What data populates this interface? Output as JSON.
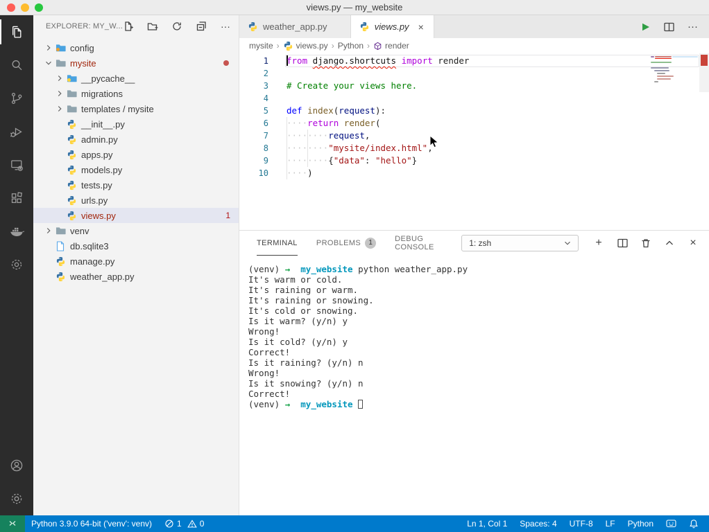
{
  "window": {
    "title": "views.py — my_website"
  },
  "activity_bar": {
    "items_top": [
      "explorer-icon",
      "search-icon",
      "source-control-icon",
      "run-debug-icon",
      "remote-explorer-icon",
      "extensions-icon",
      "docker-icon",
      "gear-badge-icon"
    ],
    "items_bottom": [
      "account-icon",
      "settings-gear-icon"
    ],
    "active": "explorer-icon"
  },
  "sidebar": {
    "title": "EXPLORER: MY_W...",
    "actions": [
      {
        "name": "new-file",
        "glyph": ""
      },
      {
        "name": "new-folder",
        "glyph": ""
      },
      {
        "name": "refresh",
        "glyph": ""
      },
      {
        "name": "collapse-all",
        "glyph": ""
      },
      {
        "name": "more",
        "glyph": "···"
      }
    ],
    "tree": [
      {
        "label": "config",
        "depth": 0,
        "chevron": "right",
        "icon": "folder-config"
      },
      {
        "label": "mysite",
        "depth": 0,
        "chevron": "down",
        "icon": "folder-gray",
        "error": true,
        "dot": true
      },
      {
        "label": "__pycache__",
        "depth": 1,
        "chevron": "right",
        "icon": "folder-python"
      },
      {
        "label": "migrations",
        "depth": 1,
        "chevron": "right",
        "icon": "folder-gray"
      },
      {
        "label": "templates / mysite",
        "depth": 1,
        "chevron": "right",
        "icon": "folder-gray"
      },
      {
        "label": "__init__.py",
        "depth": 1,
        "icon": "python"
      },
      {
        "label": "admin.py",
        "depth": 1,
        "icon": "python"
      },
      {
        "label": "apps.py",
        "depth": 1,
        "icon": "python"
      },
      {
        "label": "models.py",
        "depth": 1,
        "icon": "python"
      },
      {
        "label": "tests.py",
        "depth": 1,
        "icon": "python"
      },
      {
        "label": "urls.py",
        "depth": 1,
        "icon": "python"
      },
      {
        "label": "views.py",
        "depth": 1,
        "icon": "python",
        "error": true,
        "selected": true,
        "badge": "1"
      },
      {
        "label": "venv",
        "depth": 0,
        "chevron": "right",
        "icon": "folder-gray"
      },
      {
        "label": "db.sqlite3",
        "depth": 0,
        "icon": "file-db"
      },
      {
        "label": "manage.py",
        "depth": 0,
        "icon": "python"
      },
      {
        "label": "weather_app.py",
        "depth": 0,
        "icon": "python"
      }
    ]
  },
  "editor": {
    "tabs": [
      {
        "label": "weather_app.py",
        "active": false,
        "italic": false,
        "icon": "python"
      },
      {
        "label": "views.py",
        "active": true,
        "italic": true,
        "icon": "python",
        "close": "×"
      }
    ],
    "actions": [
      {
        "name": "run",
        "glyph": ""
      },
      {
        "name": "split-editor",
        "glyph": ""
      },
      {
        "name": "more",
        "glyph": "···"
      }
    ],
    "breadcrumb": [
      {
        "label": "mysite"
      },
      {
        "label": "views.py",
        "icon": "python"
      },
      {
        "label": "Python"
      },
      {
        "label": "render",
        "icon": "symbol-module"
      }
    ],
    "code": [
      {
        "n": 1,
        "cursor": true,
        "t": [
          [
            "kw",
            "from"
          ],
          [
            "pl",
            " "
          ],
          [
            "err",
            "django.shortcuts"
          ],
          [
            "pl",
            " "
          ],
          [
            "kw",
            "import"
          ],
          [
            "pl",
            " render"
          ]
        ]
      },
      {
        "n": 2,
        "t": []
      },
      {
        "n": 3,
        "t": [
          [
            "cm",
            "# Create your views here."
          ]
        ]
      },
      {
        "n": 4,
        "t": []
      },
      {
        "n": 5,
        "t": [
          [
            "def",
            "def"
          ],
          [
            "pl",
            " "
          ],
          [
            "fn",
            "index"
          ],
          [
            "pl",
            "("
          ],
          [
            "var",
            "request"
          ],
          [
            "pl",
            "):"
          ]
        ]
      },
      {
        "n": 6,
        "t": [
          [
            "ws",
            "    "
          ],
          [
            "kw",
            "return"
          ],
          [
            "pl",
            " "
          ],
          [
            "fn",
            "render"
          ],
          [
            "pl",
            "("
          ]
        ]
      },
      {
        "n": 7,
        "t": [
          [
            "ws",
            "        "
          ],
          [
            "var",
            "request"
          ],
          [
            "pl",
            ","
          ]
        ]
      },
      {
        "n": 8,
        "t": [
          [
            "ws",
            "        "
          ],
          [
            "str",
            "\"mysite/index.html\""
          ],
          [
            "pl",
            ","
          ]
        ]
      },
      {
        "n": 9,
        "t": [
          [
            "ws",
            "        "
          ],
          [
            "pl",
            "{"
          ],
          [
            "str",
            "\"data\""
          ],
          [
            "pl",
            ": "
          ],
          [
            "str",
            "\"hello\""
          ],
          [
            "pl",
            "}"
          ]
        ]
      },
      {
        "n": 10,
        "t": [
          [
            "ws",
            "    "
          ],
          [
            "pl",
            ")"
          ]
        ]
      }
    ]
  },
  "panel": {
    "tabs": [
      {
        "label": "TERMINAL",
        "active": true
      },
      {
        "label": "PROBLEMS",
        "badge": "1"
      },
      {
        "label": "DEBUG CONSOLE"
      }
    ],
    "shell_selector": "1: zsh",
    "actions": [
      {
        "name": "new-terminal",
        "glyph": "+"
      },
      {
        "name": "split-terminal",
        "glyph": ""
      },
      {
        "name": "kill-terminal",
        "glyph": ""
      },
      {
        "name": "maximize-panel",
        "glyph": ""
      },
      {
        "name": "close-panel",
        "glyph": "×"
      }
    ],
    "terminal": [
      {
        "t": [
          [
            "d",
            "(venv) "
          ],
          [
            "g",
            "→"
          ],
          [
            "d",
            "  "
          ],
          [
            "c",
            "my_website"
          ],
          [
            "d",
            " python weather_app.py"
          ]
        ]
      },
      {
        "t": [
          [
            "d",
            "It's warm or cold."
          ]
        ]
      },
      {
        "t": [
          [
            "d",
            "It's raining or warm."
          ]
        ]
      },
      {
        "t": [
          [
            "d",
            "It's raining or snowing."
          ]
        ]
      },
      {
        "t": [
          [
            "d",
            "It's cold or snowing."
          ]
        ]
      },
      {
        "t": [
          [
            "d",
            "Is it warm? (y/n) y"
          ]
        ]
      },
      {
        "t": [
          [
            "d",
            "Wrong!"
          ]
        ]
      },
      {
        "t": [
          [
            "d",
            "Is it cold? (y/n) y"
          ]
        ]
      },
      {
        "t": [
          [
            "d",
            "Correct!"
          ]
        ]
      },
      {
        "t": [
          [
            "d",
            "Is it raining? (y/n) n"
          ]
        ]
      },
      {
        "t": [
          [
            "d",
            "Wrong!"
          ]
        ]
      },
      {
        "t": [
          [
            "d",
            "Is it snowing? (y/n) n"
          ]
        ]
      },
      {
        "t": [
          [
            "d",
            "Correct!"
          ]
        ]
      },
      {
        "t": [
          [
            "d",
            "(venv) "
          ],
          [
            "g",
            "→"
          ],
          [
            "d",
            "  "
          ],
          [
            "c",
            "my_website"
          ],
          [
            "d",
            " "
          ]
        ],
        "cursor": true
      }
    ]
  },
  "status_bar": {
    "interpreter": "Python 3.9.0 64-bit ('venv': venv)",
    "problems": {
      "errors": "1",
      "warnings": "0"
    },
    "right": [
      "Ln 1, Col 1",
      "Spaces: 4",
      "UTF-8",
      "LF",
      "Python"
    ]
  },
  "colors": {
    "accent": "#007acc",
    "remote_green": "#16825d",
    "error_red": "#a1260d",
    "squiggle": "#e51400",
    "terminal_cyan": "#0598bc",
    "terminal_green": "#16a249"
  }
}
